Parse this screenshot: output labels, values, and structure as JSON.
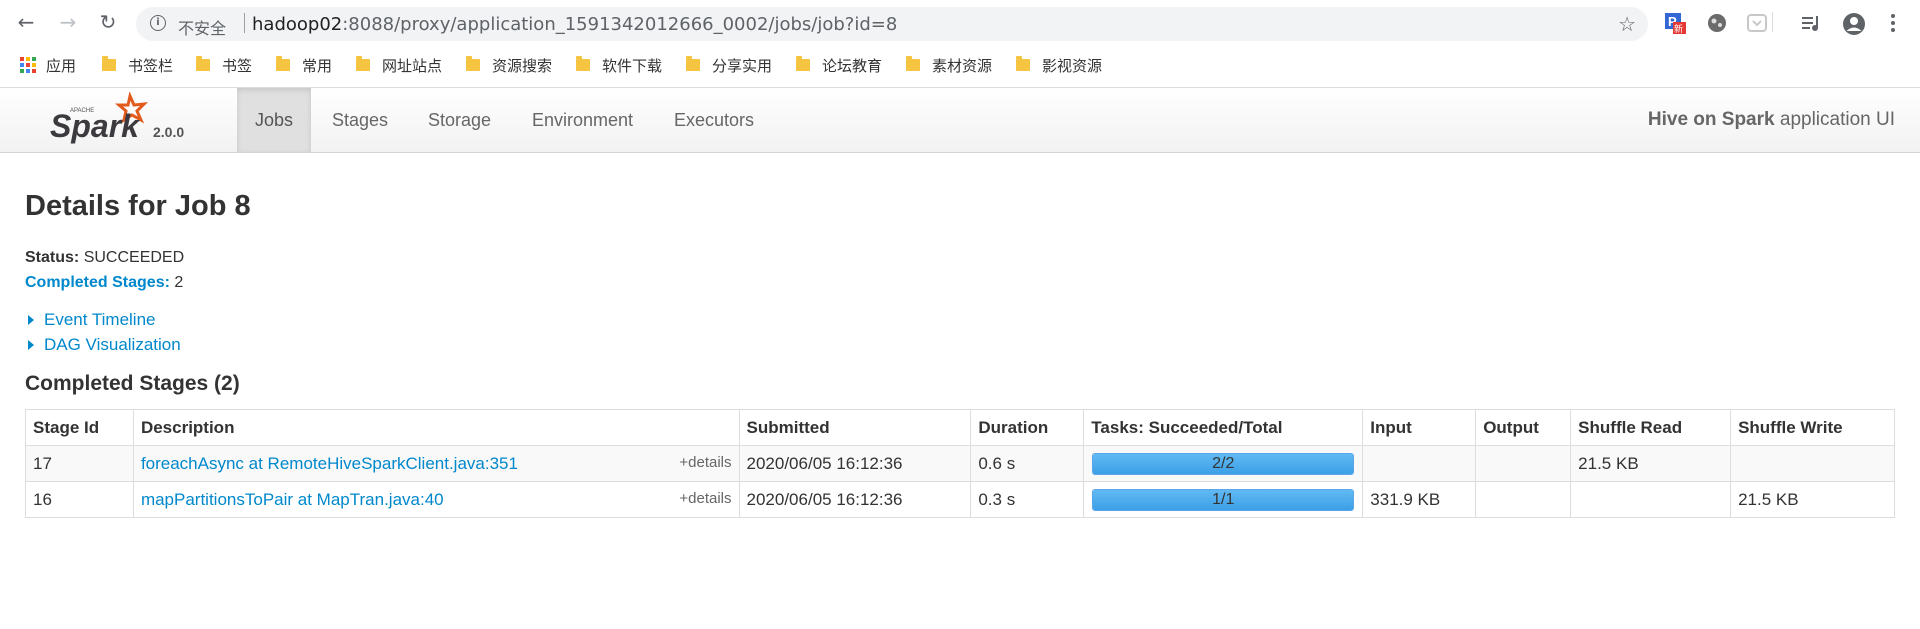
{
  "browser": {
    "insecure_label": "不安全",
    "url_host": "hadoop02",
    "url_rest": ":8088/proxy/application_1591342012666_0002/jobs/job?id=8",
    "bookmarks": [
      "应用",
      "书签栏",
      "书签",
      "常用",
      "网址站点",
      "资源搜索",
      "软件下载",
      "分享实用",
      "论坛教育",
      "素材资源",
      "影视资源"
    ]
  },
  "navbar": {
    "brand_small": "APACHE",
    "brand": "Spark",
    "version": "2.0.0",
    "tabs": [
      "Jobs",
      "Stages",
      "Storage",
      "Environment",
      "Executors"
    ],
    "active_tab": "Jobs",
    "app_name": "Hive on Spark",
    "app_suffix": " application UI"
  },
  "job": {
    "title": "Details for Job 8",
    "status_label": "Status:",
    "status_value": "SUCCEEDED",
    "completed_label": "Completed Stages:",
    "completed_value": "2",
    "event_timeline": "Event Timeline",
    "dag_visualization": "DAG Visualization"
  },
  "stages": {
    "section_title": "Completed Stages (2)",
    "columns": [
      "Stage Id",
      "Description",
      "Submitted",
      "Duration",
      "Tasks: Succeeded/Total",
      "Input",
      "Output",
      "Shuffle Read",
      "Shuffle Write"
    ],
    "details_label": "+details",
    "rows": [
      {
        "id": "17",
        "description": "foreachAsync at RemoteHiveSparkClient.java:351",
        "submitted": "2020/06/05 16:12:36",
        "duration": "0.6 s",
        "tasks": "2/2",
        "tasks_fraction": 1.0,
        "input": "",
        "output": "",
        "shuffle_read": "21.5 KB",
        "shuffle_write": ""
      },
      {
        "id": "16",
        "description": "mapPartitionsToPair at MapTran.java:40",
        "submitted": "2020/06/05 16:12:36",
        "duration": "0.3 s",
        "tasks": "1/1",
        "tasks_fraction": 1.0,
        "input": "331.9 KB",
        "output": "",
        "shuffle_read": "",
        "shuffle_write": "21.5 KB"
      }
    ]
  }
}
